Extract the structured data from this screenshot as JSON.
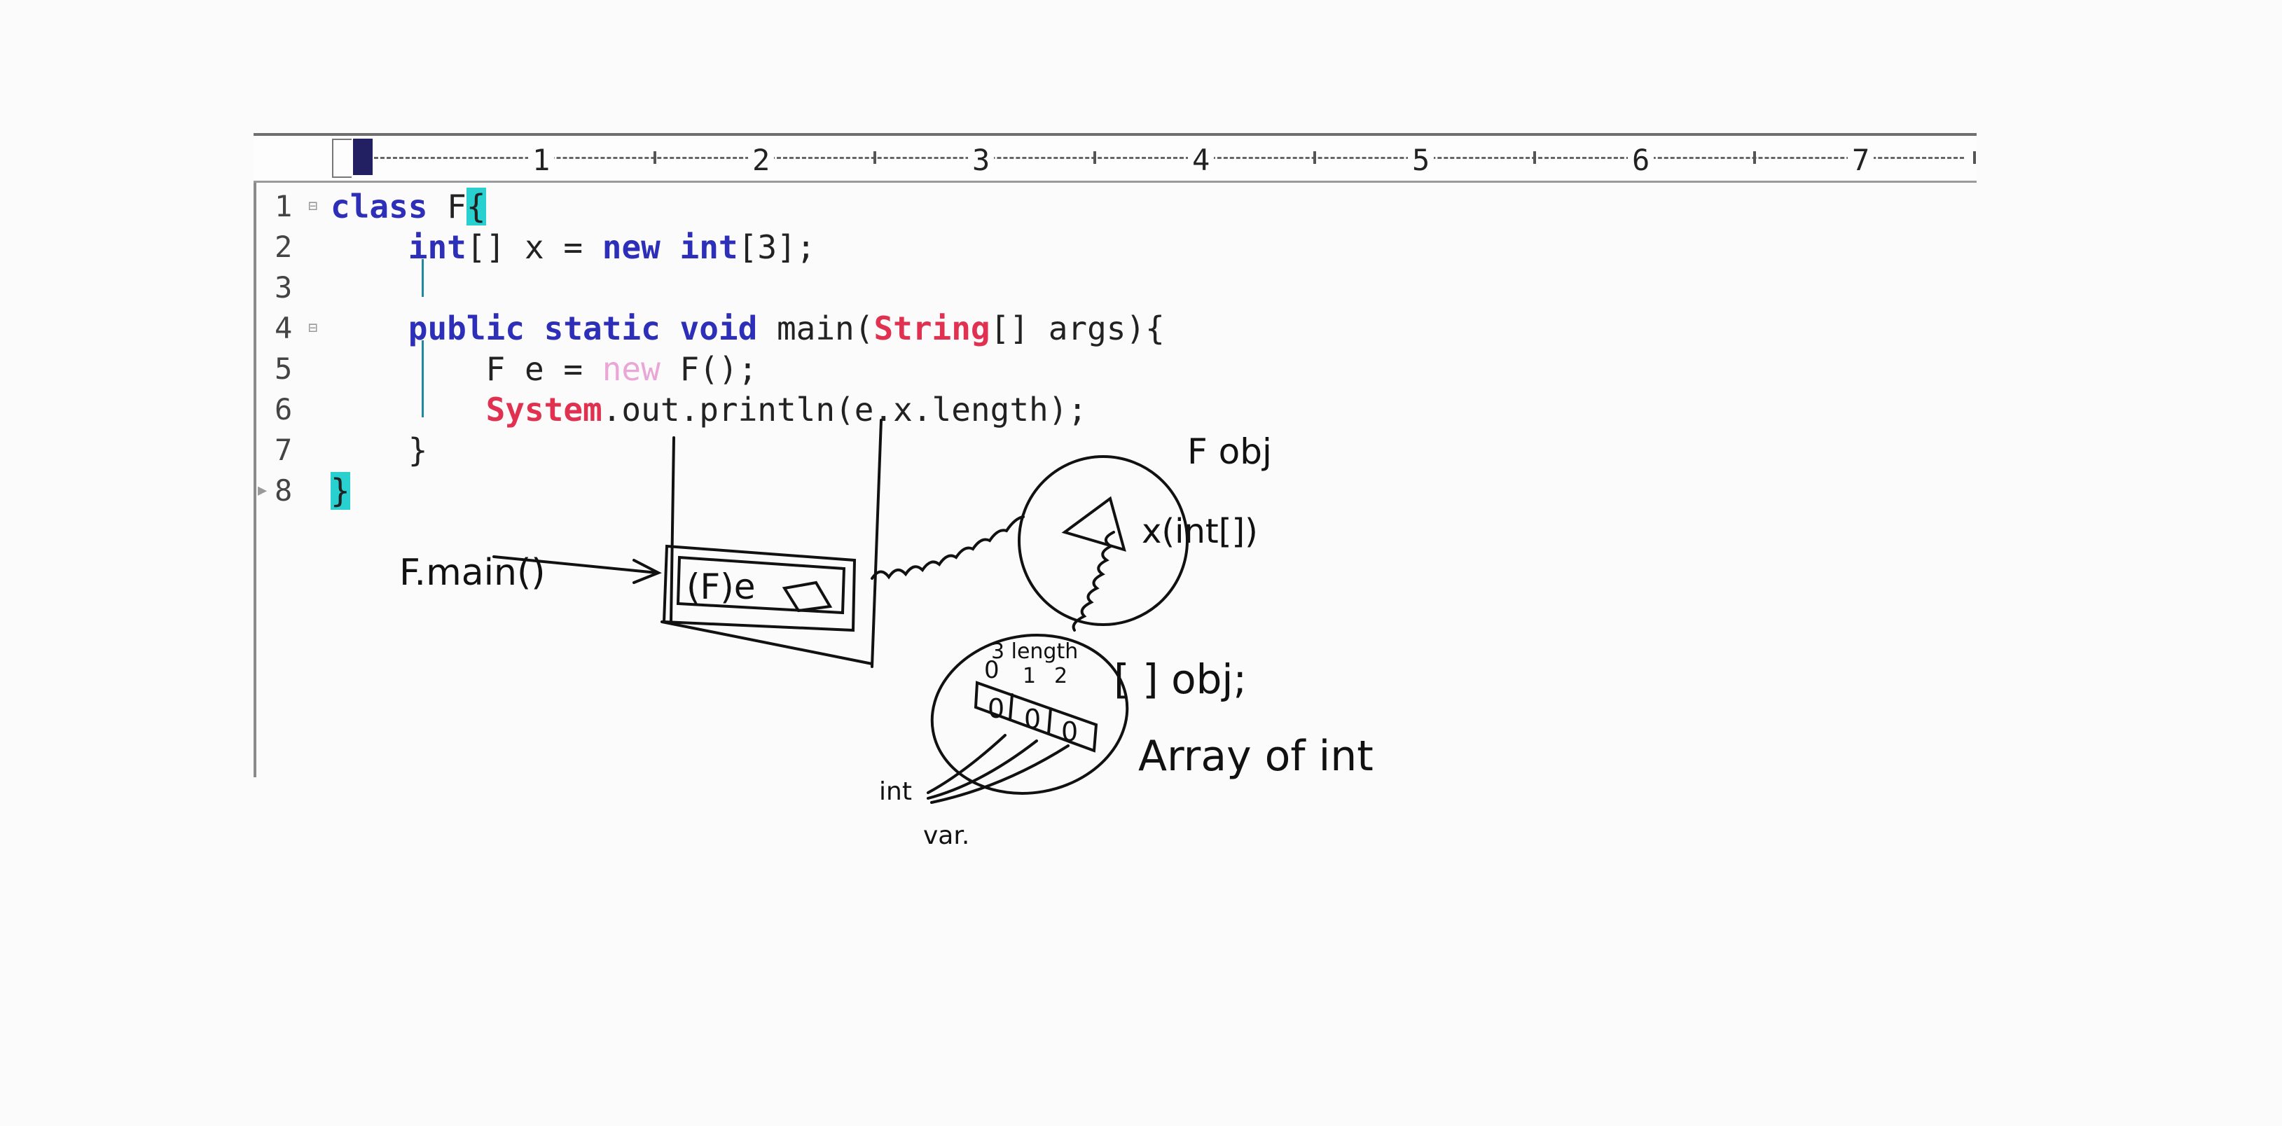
{
  "ruler": {
    "numbers": [
      "1",
      "2",
      "3",
      "4",
      "5",
      "6",
      "7"
    ]
  },
  "lines": [
    {
      "n": "1",
      "tokens": [
        [
          "kw",
          "class"
        ],
        [
          "plain",
          " F"
        ],
        [
          "brace-hl",
          "{"
        ]
      ]
    },
    {
      "n": "2",
      "tokens": [
        [
          "plain",
          "    "
        ],
        [
          "kw",
          "int"
        ],
        [
          "plain",
          "[] x = "
        ],
        [
          "kw",
          "new"
        ],
        [
          "plain",
          " "
        ],
        [
          "kw",
          "int"
        ],
        [
          "plain",
          "[3];"
        ]
      ]
    },
    {
      "n": "3",
      "tokens": []
    },
    {
      "n": "4",
      "tokens": [
        [
          "plain",
          "    "
        ],
        [
          "kw",
          "public static void"
        ],
        [
          "plain",
          " main("
        ],
        [
          "cls",
          "String"
        ],
        [
          "plain",
          "[] args){"
        ]
      ]
    },
    {
      "n": "5",
      "tokens": [
        [
          "plain",
          "        F e = "
        ],
        [
          "faint",
          "new"
        ],
        [
          "plain",
          " F();"
        ]
      ]
    },
    {
      "n": "6",
      "tokens": [
        [
          "plain",
          "        "
        ],
        [
          "cls",
          "System"
        ],
        [
          "plain",
          ".out.println(e.x.length);"
        ]
      ]
    },
    {
      "n": "7",
      "tokens": [
        [
          "plain",
          "    }"
        ]
      ]
    },
    {
      "n": "8",
      "tokens": [
        [
          "brace-hl",
          "}"
        ]
      ]
    }
  ],
  "annotations": {
    "stack_label": "F.main()",
    "frame_var": "(F)e",
    "obj_label": "F obj",
    "field_label": "x(int[])",
    "length_label": "3 length",
    "indices": [
      "0",
      "1",
      "2"
    ],
    "cells": [
      "0",
      "0",
      "0"
    ],
    "array_label_1": "[ ] obj;",
    "array_label_2": "Array of int",
    "var_label_1": "int",
    "var_label_2": "var."
  }
}
